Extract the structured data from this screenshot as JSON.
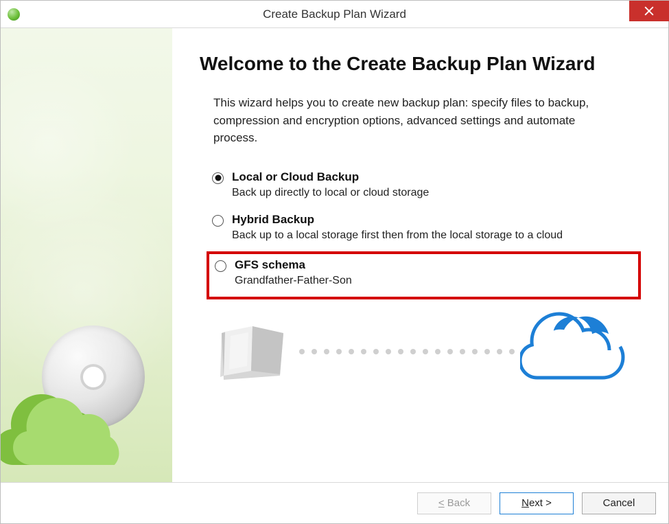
{
  "titlebar": {
    "title": "Create Backup Plan Wizard"
  },
  "main": {
    "heading": "Welcome to the Create Backup Plan Wizard",
    "intro": "This wizard helps you to create new backup plan: specify files to backup, compression and encryption options, advanced settings and automate process."
  },
  "options": [
    {
      "id": "local-cloud",
      "label": "Local or Cloud Backup",
      "desc": "Back up directly to local or cloud storage",
      "selected": true,
      "highlight": false
    },
    {
      "id": "hybrid",
      "label": "Hybrid Backup",
      "desc": "Back up to a local storage first then from the local storage to a cloud",
      "selected": false,
      "highlight": false
    },
    {
      "id": "gfs",
      "label": "GFS schema",
      "desc": "Grandfather-Father-Son",
      "selected": false,
      "highlight": true
    }
  ],
  "footer": {
    "back": "< Back",
    "next": "Next >",
    "cancel": "Cancel"
  }
}
